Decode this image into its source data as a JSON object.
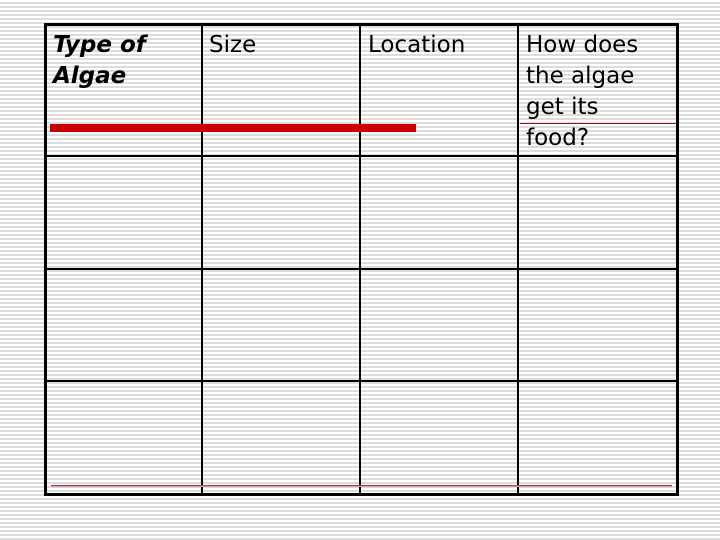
{
  "table": {
    "headers": [
      {
        "lines": [
          "Type of",
          "Algae"
        ]
      },
      {
        "lines": [
          "Size"
        ]
      },
      {
        "lines": [
          "Location"
        ]
      },
      {
        "lines": [
          "How does",
          "the algae",
          "get its",
          "food?"
        ]
      }
    ],
    "rows": [
      [
        "",
        "",
        "",
        ""
      ],
      [
        "",
        "",
        "",
        ""
      ],
      [
        "",
        "",
        "",
        ""
      ]
    ]
  },
  "colors": {
    "accent_red": "#cc0000",
    "border": "#000000",
    "stripe": "#dcdcdc"
  }
}
